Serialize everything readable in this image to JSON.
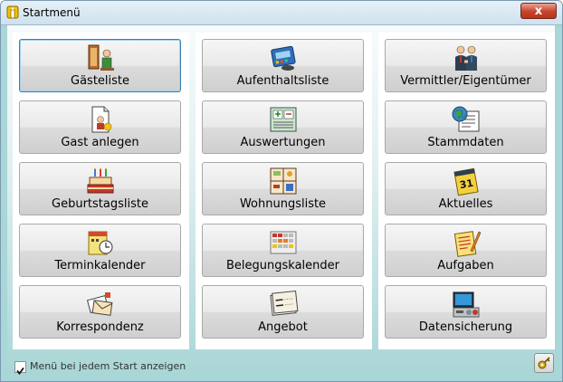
{
  "window": {
    "title": "Startmenü",
    "close_label": "x"
  },
  "columns": [
    {
      "tiles": [
        {
          "label": "Gästeliste",
          "icon": "guest-list-icon",
          "focused": true
        },
        {
          "label": "Gast anlegen",
          "icon": "new-guest-icon"
        },
        {
          "label": "Geburtstagsliste",
          "icon": "birthday-cake-icon"
        },
        {
          "label": "Terminkalender",
          "icon": "appointment-calendar-icon"
        },
        {
          "label": "Korrespondenz",
          "icon": "correspondence-icon"
        }
      ]
    },
    {
      "tiles": [
        {
          "label": "Aufenthaltsliste",
          "icon": "stay-list-icon"
        },
        {
          "label": "Auswertungen",
          "icon": "reports-icon"
        },
        {
          "label": "Wohnungsliste",
          "icon": "apartment-list-icon"
        },
        {
          "label": "Belegungskalender",
          "icon": "occupancy-calendar-icon"
        },
        {
          "label": "Angebot",
          "icon": "offer-icon"
        }
      ]
    },
    {
      "tiles": [
        {
          "label": "Vermittler/Eigentümer",
          "icon": "agents-owners-icon"
        },
        {
          "label": "Stammdaten",
          "icon": "master-data-icon"
        },
        {
          "label": "Aktuelles",
          "icon": "news-calendar-icon"
        },
        {
          "label": "Aufgaben",
          "icon": "tasks-icon"
        },
        {
          "label": "Datensicherung",
          "icon": "backup-icon"
        }
      ]
    }
  ],
  "footer": {
    "checkbox_label": "Menü bei jedem Start anzeigen",
    "checked": true,
    "settings_icon": "key-settings-icon"
  }
}
